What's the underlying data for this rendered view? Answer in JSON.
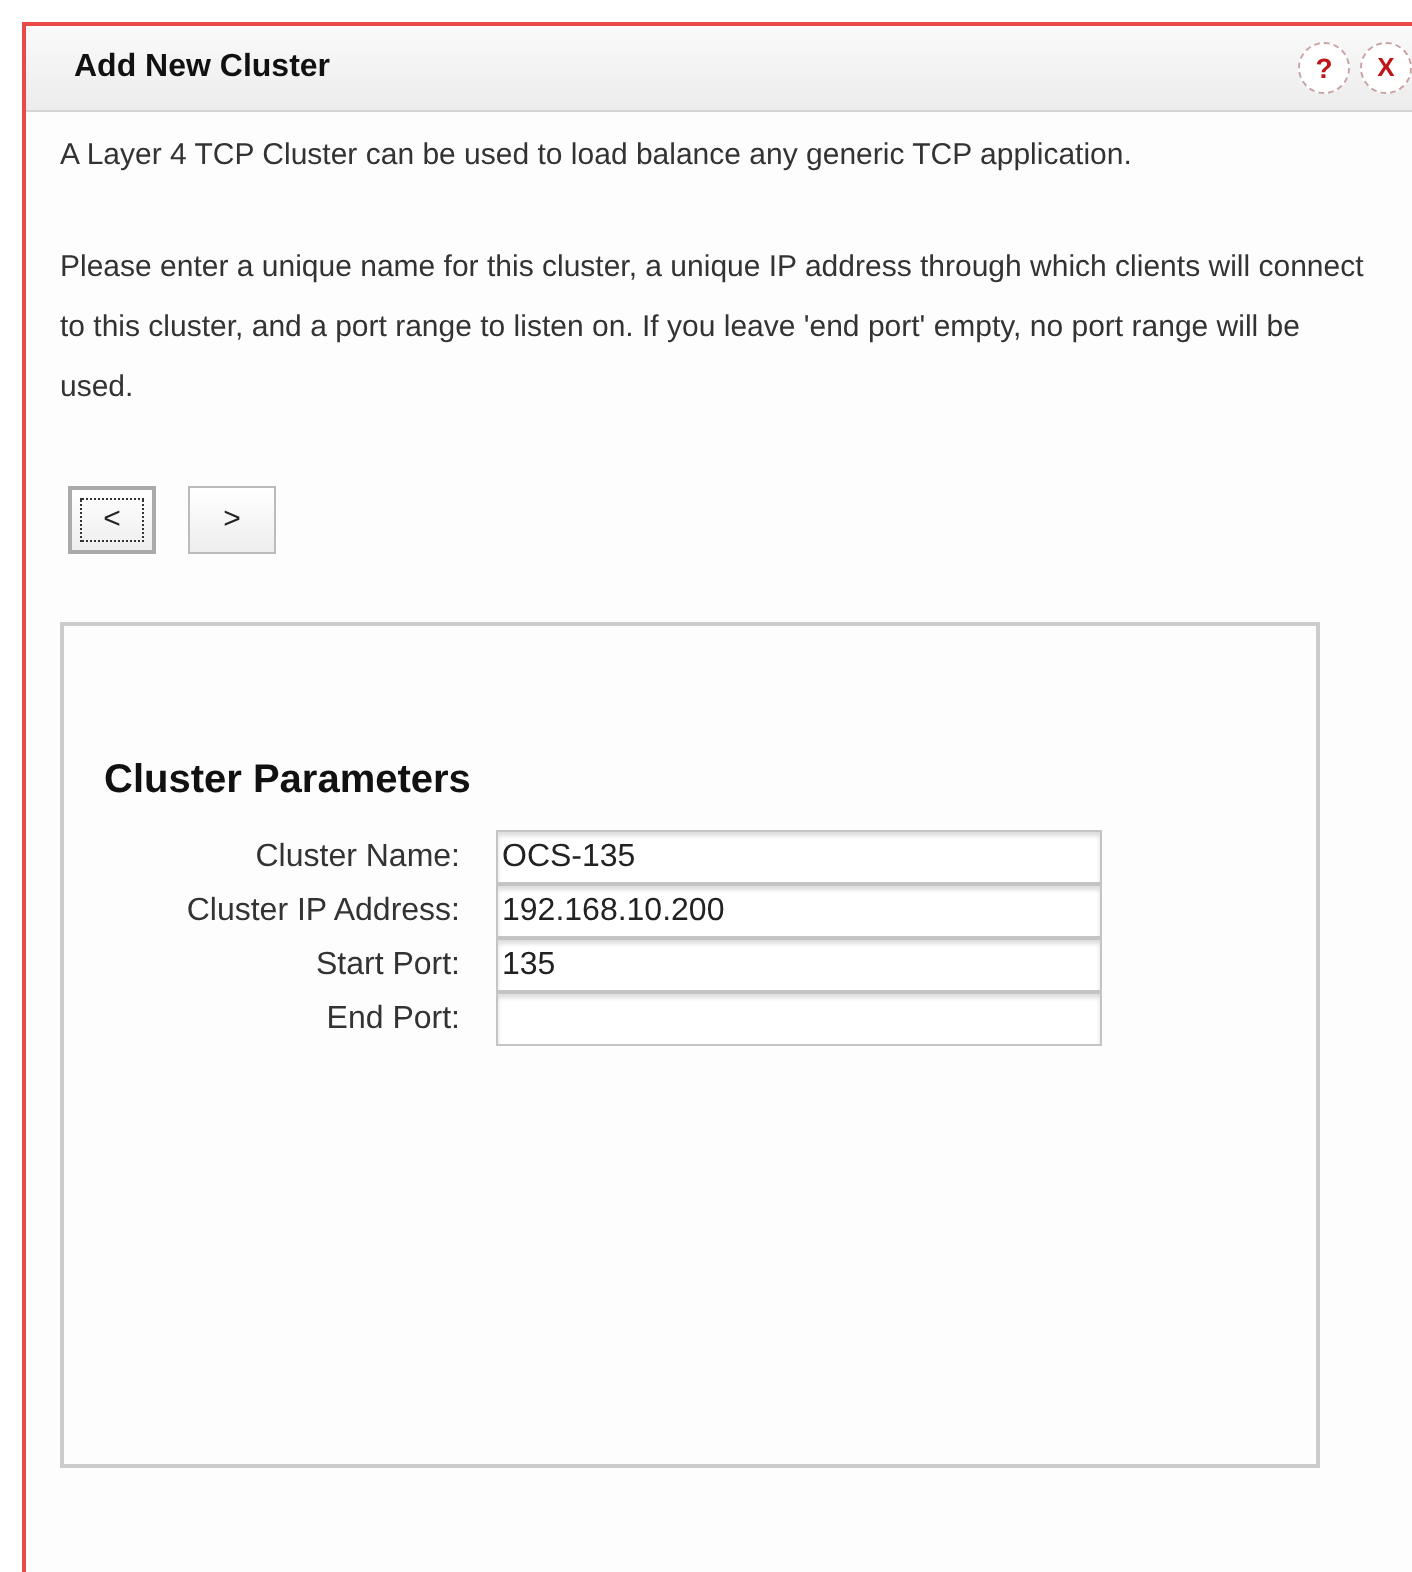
{
  "dialog": {
    "title": "Add New Cluster",
    "header_buttons": [
      {
        "kind": "help",
        "label": "?"
      },
      {
        "kind": "close",
        "label": "X"
      }
    ]
  },
  "intro": "A Layer 4 TCP Cluster can be used to load balance any generic TCP application.",
  "instructions": "Please enter a unique name for this cluster, a unique IP address through which clients will connect to this cluster, and a port range to listen on. If you leave 'end port' empty, no port range will be used.",
  "nav_buttons": [
    {
      "label": "<",
      "focused": true
    },
    {
      "label": ">",
      "focused": false
    }
  ],
  "panel": {
    "heading": "Cluster Parameters",
    "fields": [
      {
        "label": "Cluster Name:",
        "value": "OCS-135"
      },
      {
        "label": "Cluster IP Address:",
        "value": "192.168.10.200"
      },
      {
        "label": "Start Port:",
        "value": "135"
      },
      {
        "label": "End Port:"
      }
    ]
  }
}
